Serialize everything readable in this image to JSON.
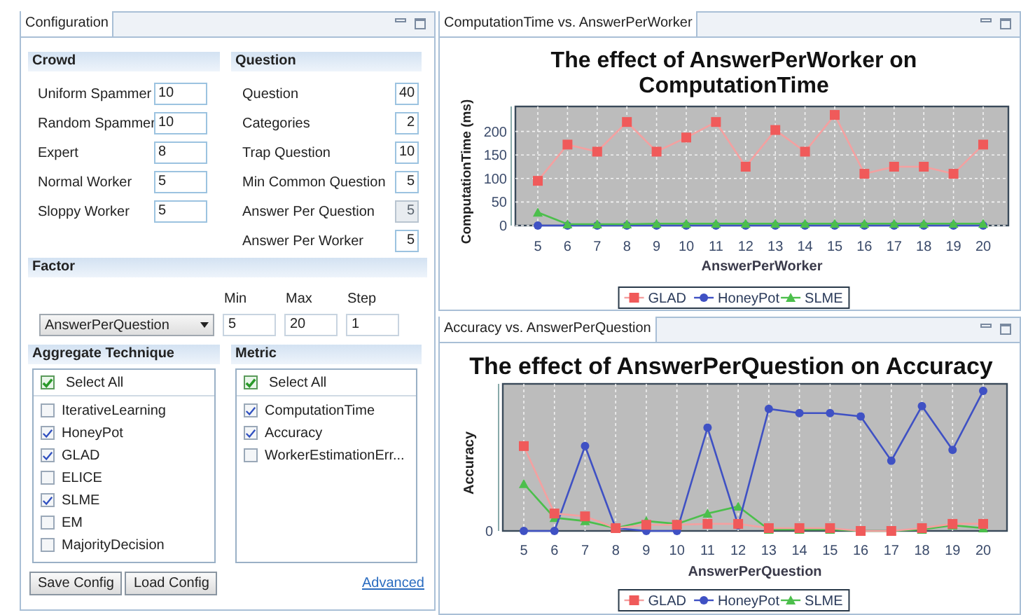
{
  "config": {
    "tab": "Configuration",
    "crowd": {
      "title": "Crowd",
      "fields": [
        {
          "label": "Uniform Spammer",
          "value": "10"
        },
        {
          "label": "Random Spammer",
          "value": "10"
        },
        {
          "label": "Expert",
          "value": "8"
        },
        {
          "label": "Normal Worker",
          "value": "5"
        },
        {
          "label": "Sloppy Worker",
          "value": "5"
        }
      ]
    },
    "question": {
      "title": "Question",
      "fields": [
        {
          "label": "Question",
          "value": "40",
          "disabled": false
        },
        {
          "label": "Categories",
          "value": "2",
          "disabled": false
        },
        {
          "label": "Trap Question",
          "value": "10",
          "disabled": false
        },
        {
          "label": "Min Common Question",
          "value": "5",
          "disabled": false
        },
        {
          "label": "Answer Per Question",
          "value": "5",
          "disabled": true
        },
        {
          "label": "Answer Per Worker",
          "value": "5",
          "disabled": false
        }
      ]
    },
    "factor": {
      "title": "Factor",
      "dropdown": "AnswerPerQuestion",
      "ranges": [
        {
          "label": "Min",
          "value": "5"
        },
        {
          "label": "Max",
          "value": "20"
        },
        {
          "label": "Step",
          "value": "1"
        }
      ]
    },
    "aggregate": {
      "title": "Aggregate Technique",
      "select_all": {
        "label": "Select All",
        "checked": true
      },
      "items": [
        {
          "label": "IterativeLearning",
          "checked": false
        },
        {
          "label": "HoneyPot",
          "checked": true
        },
        {
          "label": "GLAD",
          "checked": true
        },
        {
          "label": "ELICE",
          "checked": false
        },
        {
          "label": "SLME",
          "checked": true
        },
        {
          "label": "EM",
          "checked": false
        },
        {
          "label": "MajorityDecision",
          "checked": false
        }
      ]
    },
    "metric": {
      "title": "Metric",
      "select_all": {
        "label": "Select All",
        "checked": true
      },
      "items": [
        {
          "label": "ComputationTime",
          "checked": true
        },
        {
          "label": "Accuracy",
          "checked": true
        },
        {
          "label": "WorkerEstimationErr...",
          "checked": false
        }
      ]
    },
    "buttons": [
      "Save Config",
      "Load Config"
    ],
    "link": "Advanced"
  },
  "time_panel": {
    "tab": "ComputationTime vs. AnswerPerWorker",
    "chart_data": {
      "type": "line",
      "title": "The effect of AnswerPerWorker on ComputationTime",
      "xlabel": "AnswerPerWorker",
      "ylabel": "ComputationTime (ms)",
      "categories": [
        "5",
        "6",
        "7",
        "8",
        "9",
        "10",
        "11",
        "12",
        "13",
        "14",
        "15",
        "16",
        "17",
        "18",
        "19",
        "20"
      ],
      "series": [
        {
          "name": "GLAD",
          "color": "#f05a5a",
          "marker": "square",
          "values": [
            95,
            172,
            157,
            220,
            157,
            187,
            220,
            125,
            203,
            157,
            235,
            110,
            125,
            125,
            110,
            172
          ]
        },
        {
          "name": "HoneyPot",
          "color": "#3f51c4",
          "marker": "circle",
          "values": [
            0,
            0,
            0,
            0,
            0,
            0,
            0,
            0,
            0,
            0,
            0,
            0,
            0,
            0,
            0,
            0
          ]
        },
        {
          "name": "SLME",
          "color": "#4cbf4c",
          "marker": "triangle",
          "values": [
            28,
            3,
            3,
            3,
            4,
            4,
            4,
            4,
            4,
            4,
            4,
            4,
            4,
            4,
            4,
            4
          ]
        }
      ],
      "ylim": [
        0,
        250
      ],
      "yticks": [
        0,
        50,
        100,
        150,
        200
      ],
      "grid": true,
      "legend": true
    }
  },
  "accuracy_panel": {
    "tab": "Accuracy vs. AnswerPerQuestion",
    "chart": {
      "title": "The effect of AnswerPerQuestion on Accuracy",
      "xlabel": "AnswerPerQuestion",
      "ylabel": "Accuracy",
      "y_tick_label": "0",
      "x_tick_labels": [
        "5",
        "6",
        "7",
        "8",
        "9",
        "10",
        "11",
        "12",
        "13",
        "14",
        "15",
        "16",
        "17",
        "18",
        "19",
        "20"
      ],
      "legend": [
        {
          "name": "GLAD",
          "color": "#f05a5a"
        },
        {
          "name": "HoneyPot",
          "color": "#3f51c4"
        },
        {
          "name": "SLME",
          "color": "#4cbf4c"
        }
      ]
    }
  }
}
